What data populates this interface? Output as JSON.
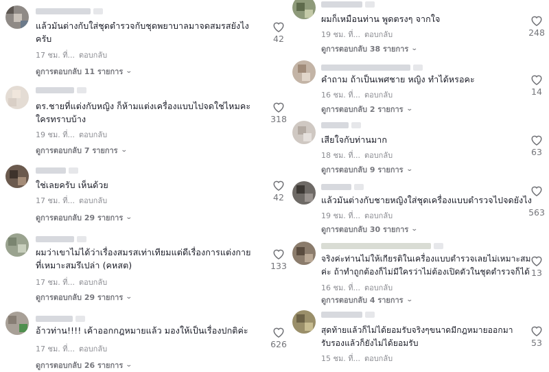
{
  "reply_label": "ตอบกลับ",
  "left": [
    {
      "text": "แล้วมันต่างกับใส่ชุดตำรวจกับชุดพยาบาลมาจดสมรสยังไง\nครับ",
      "time": "17 ชม. ที่...",
      "likes": "42",
      "view_replies": "ดูการตอบกลับ 11 รายการ"
    },
    {
      "text": "ตร.ชายที่แต่งกับหญิง ก็ห้ามแต่งเครื่องแบบไปจดใช่ไหมคะ\nใครทราบบ้าง",
      "time": "19 ชม. ที่...",
      "likes": "318",
      "view_replies": "ดูการตอบกลับ 7 รายการ"
    },
    {
      "text": "ใช่เลยครับ เห็นด้วย",
      "time": "17 ชม. ที่...",
      "likes": "42",
      "view_replies": "ดูการตอบกลับ 29 รายการ"
    },
    {
      "text": "ผมว่าเขาไม่ได้ว่าเรื่องสมรสเท่าเทียมแต่ดีเรื่องการแต่งกาย\nที่เหมาะสมรึเปล่า (คหสต)",
      "time": "17 ชม. ที่...",
      "likes": "133",
      "view_replies": "ดูการตอบกลับ 29 รายการ"
    },
    {
      "text": "อ้าวท่าน!!!! เค้าออกกฎหมายแล้ว มองให้เป็นเรื่องปกติค่ะ",
      "time": "17 ชม. ที่...",
      "likes": "626",
      "view_replies": "ดูการตอบกลับ 26 รายการ"
    }
  ],
  "right": [
    {
      "text": "ผมก็เหมือนท่าน พูดตรงๆ จากใจ",
      "time": "19 ชม. ที่...",
      "likes": "248",
      "view_replies": "ดูการตอบกลับ 38 รายการ"
    },
    {
      "text": "คำถาม ถ้าเป็นเพศชาย หญิง ทำได้หรอคะ",
      "time": "16 ชม. ที่...",
      "likes": "14",
      "view_replies": "ดูการตอบกลับ 2 รายการ"
    },
    {
      "text": "เสียใจกับท่านมาก",
      "time": "18 ชม. ที่...",
      "likes": "63",
      "view_replies": "ดูการตอบกลับ 9 รายการ"
    },
    {
      "text": "แล้วมันต่างกับชายหญิงใส่ชุดเครื่องแบบตำรวจไปจดยังไง",
      "time": "19 ชม. ที่...",
      "likes": "563",
      "view_replies": "ดูการตอบกลับ 30 รายการ"
    },
    {
      "text": "จริงค่ะท่านไม่ให้เกียรติในเครื่องแบบตำรวจเลยไม่เหมาะสม\nค่ะ ถ้าทำถูกต้องก็ไม่มีใครว่าไม่ต้องเปิดตัวในชุดตำรวจก็ได้",
      "time": "16 ชม. ที่...",
      "likes": "13",
      "view_replies": "ดูการตอบกลับ 4 รายการ"
    },
    {
      "text": "สุดท้ายแล้วก็ไม่ได้ยอมรับจริงๆขนาดมีกฎหมายออกมา\nรับรองแล้วก็ยังไม่ได้ยอมรับ",
      "time": "15 ชม. ที่...",
      "likes": "53",
      "view_replies": ""
    }
  ]
}
